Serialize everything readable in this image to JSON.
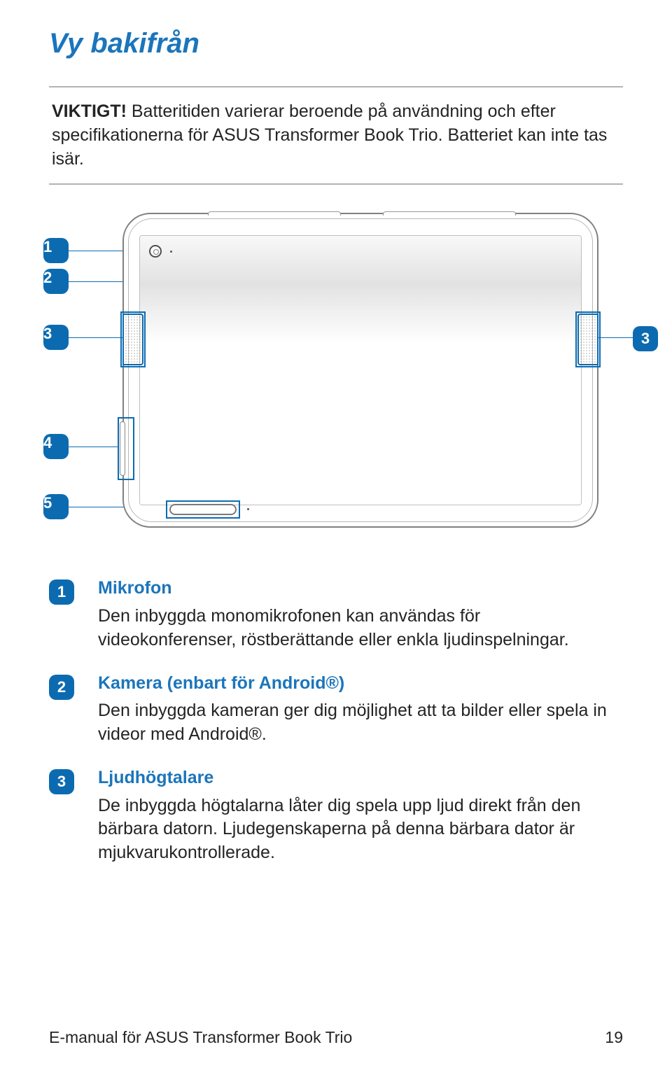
{
  "title": "Vy bakifrån",
  "note": {
    "label": "VIKTIGT!",
    "text": " Batteritiden varierar beroende på användning och efter specifikationerna för ASUS Transformer Book Trio. Batteriet kan inte tas isär."
  },
  "diagram_callouts": {
    "left": [
      "1",
      "2",
      "3",
      "4",
      "5"
    ],
    "right": "3"
  },
  "items": [
    {
      "num": "1",
      "title": "Mikrofon",
      "body": "Den inbyggda monomikrofonen kan användas för videokonferenser, röstberättande eller enkla ljudinspelningar."
    },
    {
      "num": "2",
      "title": "Kamera (enbart för Android®)",
      "body": "Den inbyggda kameran ger dig möjlighet att ta bilder eller spela in videor med Android®."
    },
    {
      "num": "3",
      "title": "Ljudhögtalare",
      "body": "De inbyggda högtalarna låter dig spela upp ljud direkt från den bärbara datorn. Ljudegenskaperna på denna bärbara dator är mjukvarukontrollerade."
    }
  ],
  "footer": {
    "left": "E-manual för ASUS Transformer Book Trio",
    "right": "19"
  }
}
